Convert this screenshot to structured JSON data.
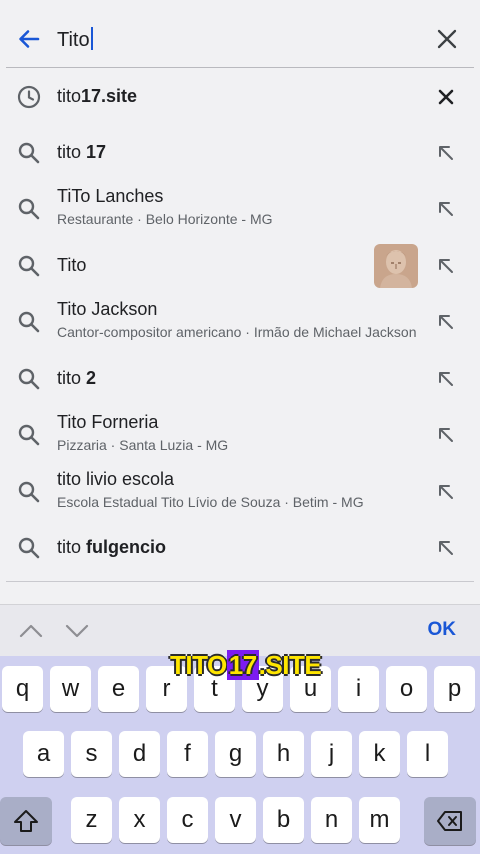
{
  "search": {
    "query": "Tito",
    "back_icon": "arrow-left-icon",
    "clear_icon": "close-icon"
  },
  "suggestions": [
    {
      "kind": "history",
      "pre": "tito",
      "bold": "17.site",
      "sub": "",
      "trail": "remove"
    },
    {
      "kind": "search",
      "pre": "tito ",
      "bold": "17",
      "sub": "",
      "trail": "fill"
    },
    {
      "kind": "search",
      "pre": "TiTo Lanches",
      "bold": "",
      "sub": "Restaurante · Belo Horizonte - MG",
      "trail": "fill"
    },
    {
      "kind": "search",
      "pre": "Tito",
      "bold": "",
      "sub": "",
      "trail": "fill",
      "thumb": "statue-bust-image"
    },
    {
      "kind": "search",
      "pre": "Tito Jackson",
      "bold": "",
      "sub": "Cantor-compositor americano · Irmão de Michael Jackson",
      "trail": "fill"
    },
    {
      "kind": "search",
      "pre": "tito ",
      "bold": "2",
      "sub": "",
      "trail": "fill"
    },
    {
      "kind": "search",
      "pre": "Tito Forneria",
      "bold": "",
      "sub": "Pizzaria · Santa Luzia - MG",
      "trail": "fill"
    },
    {
      "kind": "search",
      "pre": "tito livio escola",
      "bold": "",
      "sub": "Escola Estadual Tito Lívio de Souza · Betim - MG",
      "trail": "fill"
    },
    {
      "kind": "search",
      "pre": "tito ",
      "bold": "fulgencio",
      "sub": "",
      "trail": "fill"
    }
  ],
  "toolbar": {
    "ok_label": "OK"
  },
  "keyboard": {
    "row1": [
      "q",
      "w",
      "e",
      "r",
      "t",
      "y",
      "u",
      "i",
      "o",
      "p"
    ],
    "row2": [
      "a",
      "s",
      "d",
      "f",
      "g",
      "h",
      "j",
      "k",
      "l"
    ],
    "row3": [
      "z",
      "x",
      "c",
      "v",
      "b",
      "n",
      "m"
    ]
  },
  "watermark": {
    "pre": "TITO",
    "hl": "17",
    "post": ".SITE"
  },
  "colors": {
    "accent": "#1a57d6",
    "keyboard_bg": "#cfd0f0",
    "watermark": "#ffe600",
    "watermark_hl": "#7c1cf2"
  }
}
